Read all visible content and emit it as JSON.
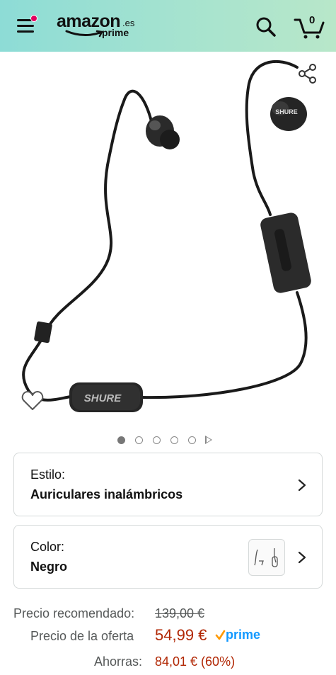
{
  "header": {
    "logo_word": "amazon",
    "logo_tld": ".es",
    "logo_sub": "prime",
    "cart_count": "0"
  },
  "icons": {
    "menu": "menu-icon",
    "search": "search-icon",
    "cart": "cart-icon",
    "share": "share-icon",
    "wishlist": "heart-icon",
    "chevron": "chevron-right-icon"
  },
  "product": {
    "image_brand_text": "SHURE",
    "carousel": {
      "total_images": 5,
      "active_index": 0,
      "has_video": true
    }
  },
  "options": {
    "style": {
      "label": "Estilo:",
      "value": "Auriculares inalámbricos"
    },
    "color": {
      "label": "Color:",
      "value": "Negro"
    }
  },
  "price": {
    "list_label": "Precio recomendado:",
    "list_value": "139,00 €",
    "deal_label": "Precio de la oferta",
    "deal_value": "54,99 €",
    "prime_text": "prime",
    "savings_label": "Ahorras:",
    "savings_value": "84,01 € (60%)"
  },
  "colors": {
    "header_start": "#8ddcd6",
    "header_end": "#b8e7c9",
    "price_red": "#b12704",
    "prime_blue": "#1399ff",
    "prime_check": "#ff9900",
    "notification_dot": "#e3005e"
  }
}
